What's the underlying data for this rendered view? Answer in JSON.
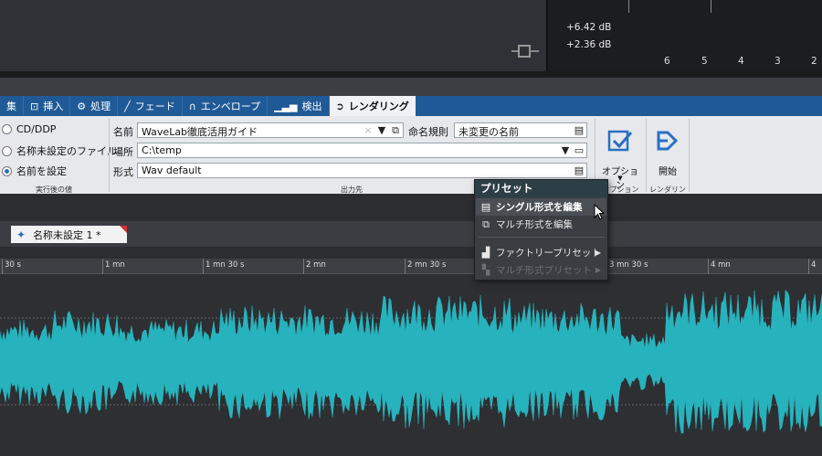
{
  "meter": {
    "db_top": "+6.42 dB",
    "db_bottom": "+2.36 dB",
    "ticks": [
      "6",
      "5",
      "4",
      "3",
      "2"
    ]
  },
  "tabs": [
    {
      "label": "集",
      "icon": ""
    },
    {
      "label": "挿入",
      "icon": "insert-icon"
    },
    {
      "label": "処理",
      "icon": "process-icon"
    },
    {
      "label": "フェード",
      "icon": "fade-icon"
    },
    {
      "label": "エンベロープ",
      "icon": "envelope-icon"
    },
    {
      "label": "検出",
      "icon": "detect-icon"
    },
    {
      "label": "レンダリング",
      "icon": "render-icon"
    }
  ],
  "ribbon": {
    "radios": [
      "CD/DDP",
      "名称未設定のファイル",
      "名前を設定"
    ],
    "selected_radio": 2,
    "group_after": "実行後の値",
    "name_label": "名前",
    "name_value": "WaveLab徹底活用ガイド",
    "naming_rule_label": "命名規則",
    "naming_rule_value": "未変更の名前",
    "location_label": "場所",
    "location_value": "C:\\temp",
    "format_label": "形式",
    "format_value": "Wav default",
    "group_output": "出力先",
    "options_label": "オプション",
    "group_options": "オプション",
    "start_label": "開始",
    "group_rendering": "レンダリング"
  },
  "document_tab": "名称未設定 1 *",
  "timeline": [
    "30 s",
    "1 mn",
    "1 mn 30 s",
    "2 mn",
    "2 mn 30 s",
    "3 mn 30 s",
    "4 mn",
    "4"
  ],
  "menu": {
    "title": "プリセット",
    "items": [
      {
        "label": "シングル形式を編集",
        "icon": "single-format-icon",
        "highlighted": true,
        "disabled": false,
        "submenu": false
      },
      {
        "label": "マルチ形式を編集",
        "icon": "multi-format-icon",
        "highlighted": false,
        "disabled": false,
        "submenu": false
      },
      {
        "label": "ファクトリープリセット",
        "icon": "factory-icon",
        "highlighted": false,
        "disabled": false,
        "submenu": true
      },
      {
        "label": "マルチ形式プリセット",
        "icon": "multi-preset-icon",
        "highlighted": false,
        "disabled": true,
        "submenu": true
      }
    ]
  },
  "colors": {
    "tab_bar": "#1f5a97",
    "waveform": "#27b3bd",
    "menu_bg": "#3a3d42"
  }
}
